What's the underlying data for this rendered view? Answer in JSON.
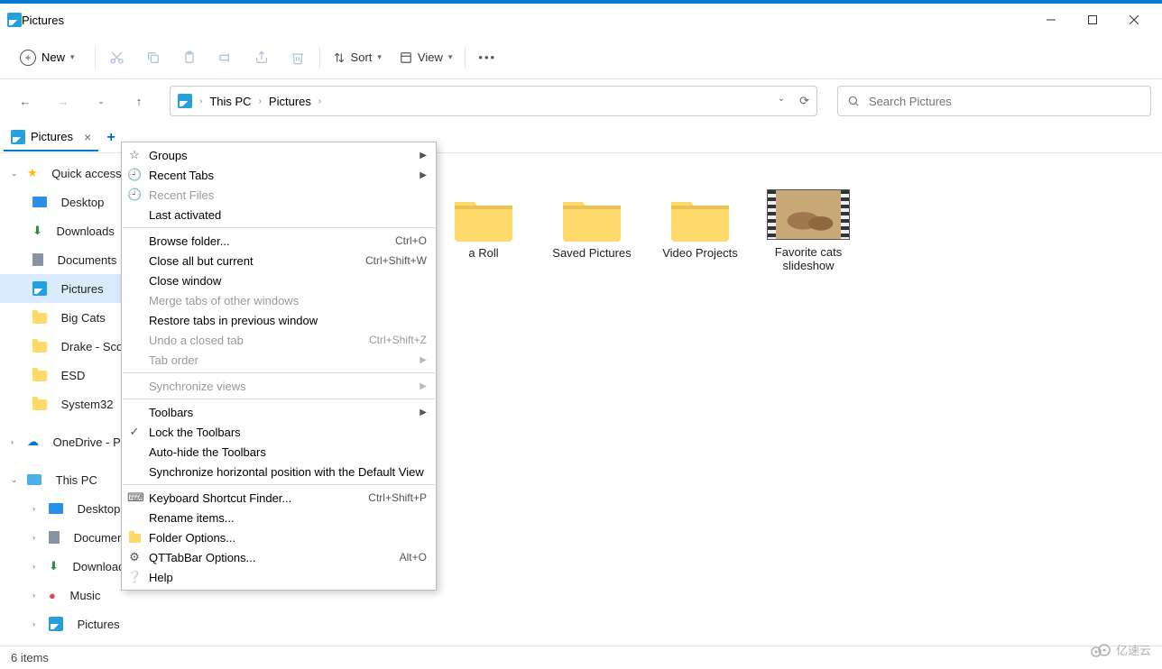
{
  "window": {
    "title": "Pictures"
  },
  "toolbar": {
    "new": "New",
    "sort": "Sort",
    "view": "View"
  },
  "breadcrumb": {
    "root": "This PC",
    "current": "Pictures"
  },
  "search": {
    "placeholder": "Search Pictures"
  },
  "tab": {
    "label": "Pictures"
  },
  "sidebar": {
    "quick_access": "Quick access",
    "desktop": "Desktop",
    "downloads": "Downloads",
    "documents": "Documents",
    "pictures": "Pictures",
    "bigcats": "Big Cats",
    "drake": "Drake - Scorpi",
    "esd": "ESD",
    "system32": "System32",
    "onedrive": "OneDrive - Per",
    "thispc": "This PC",
    "pc_desktop": "Desktop",
    "pc_documents": "Documents",
    "pc_downloads": "Downloads",
    "pc_music": "Music",
    "pc_pictures": "Pictures"
  },
  "content": {
    "items": [
      {
        "label": "a Roll"
      },
      {
        "label": "Saved Pictures"
      },
      {
        "label": "Video Projects"
      },
      {
        "label": "Favorite cats slideshow"
      }
    ]
  },
  "context_menu": {
    "groups": "Groups",
    "recent_tabs": "Recent Tabs",
    "recent_files": "Recent Files",
    "last_activated": "Last activated",
    "browse_folder": "Browse folder...",
    "browse_folder_sc": "Ctrl+O",
    "close_all_but": "Close all but current",
    "close_all_but_sc": "Ctrl+Shift+W",
    "close_window": "Close window",
    "merge_tabs": "Merge tabs of other windows",
    "restore_tabs": "Restore tabs in previous window",
    "undo_closed": "Undo a closed tab",
    "undo_closed_sc": "Ctrl+Shift+Z",
    "tab_order": "Tab order",
    "sync_views": "Synchronize views",
    "toolbars": "Toolbars",
    "lock_toolbars": "Lock the Toolbars",
    "autohide": "Auto-hide the Toolbars",
    "sync_horiz": "Synchronize horizontal position with the Default View",
    "kb_shortcut": "Keyboard Shortcut Finder...",
    "kb_shortcut_sc": "Ctrl+Shift+P",
    "rename": "Rename items...",
    "folder_options": "Folder Options...",
    "qttab_options": "QTTabBar Options...",
    "qttab_options_sc": "Alt+O",
    "help": "Help"
  },
  "status": {
    "text": "6 items"
  },
  "watermark": "亿速云"
}
